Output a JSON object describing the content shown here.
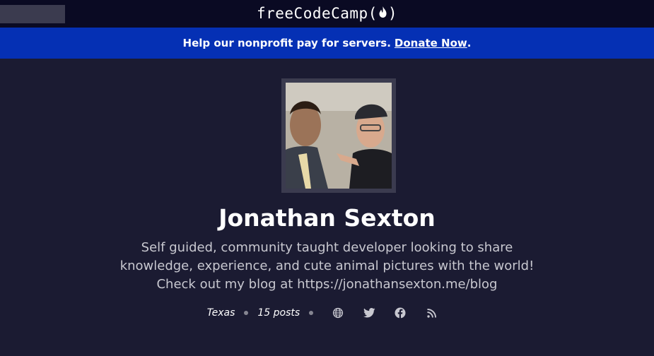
{
  "header": {
    "logo_text": "freeCodeCamp(",
    "logo_close": ")",
    "logo_icon": "flame-icon"
  },
  "banner": {
    "text": "Help our nonprofit pay for servers.",
    "link_label": "Donate Now",
    "suffix": "."
  },
  "profile": {
    "name": "Jonathan Sexton",
    "bio": "Self guided, community taught developer looking to share knowledge, experience, and cute animal pictures with the world! Check out my blog at https://jonathansexton.me/blog",
    "location": "Texas",
    "post_count": "15 posts",
    "icons": [
      "globe-icon",
      "twitter-icon",
      "facebook-icon",
      "rss-icon"
    ]
  },
  "colors": {
    "background": "#1b1b32",
    "topbar": "#0a0a23",
    "banner": "#0530b4",
    "text": "#ffffff",
    "muted": "#c8c8d0"
  }
}
